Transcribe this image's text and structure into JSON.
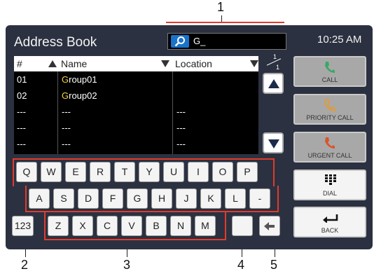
{
  "callouts": {
    "c1": "1",
    "c2": "2",
    "c3": "3",
    "c4": "4",
    "c5": "5"
  },
  "title": "Address Book",
  "search": {
    "text": "G_"
  },
  "clock": "10:25 AM",
  "table": {
    "headers": {
      "num": "#",
      "name": "Name",
      "location": "Location"
    },
    "rows": [
      {
        "num": "01",
        "name_hl": "G",
        "name_rest": "roup01",
        "location": ""
      },
      {
        "num": "02",
        "name_hl": "G",
        "name_rest": "roup02",
        "location": ""
      },
      {
        "num": "---",
        "name_hl": "",
        "name_rest": "---",
        "location": "---"
      },
      {
        "num": "---",
        "name_hl": "",
        "name_rest": "---",
        "location": "---"
      },
      {
        "num": "---",
        "name_hl": "",
        "name_rest": "---",
        "location": "---"
      }
    ]
  },
  "page": {
    "current": "1",
    "total": "1"
  },
  "keyboard": {
    "row1": [
      "Q",
      "W",
      "E",
      "R",
      "T",
      "Y",
      "U",
      "I",
      "O",
      "P"
    ],
    "row2": [
      "A",
      "S",
      "D",
      "F",
      "G",
      "H",
      "J",
      "K",
      "L",
      "-"
    ],
    "row3": [
      "Z",
      "X",
      "C",
      "V",
      "B",
      "N",
      "M"
    ],
    "mode_key": "123"
  },
  "side": {
    "call": "CALL",
    "priority": "PRIORITY CALL",
    "urgent": "URGENT CALL",
    "dial": "DIAL",
    "back": "BACK"
  },
  "colors": {
    "accent": "#1a73c9",
    "highlight": "#f1d44a",
    "callout": "#e23b2b",
    "call_icon": "#3aa863",
    "priority_icon": "#e69a2b",
    "urgent_icon": "#d9542b"
  }
}
